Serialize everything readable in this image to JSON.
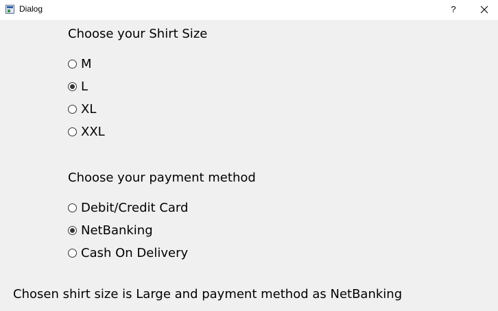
{
  "window": {
    "title": "Dialog",
    "help_label": "?"
  },
  "shirt": {
    "heading": "Choose your Shirt Size",
    "options": [
      {
        "label": "M",
        "checked": false
      },
      {
        "label": "L",
        "checked": true
      },
      {
        "label": "XL",
        "checked": false
      },
      {
        "label": "XXL",
        "checked": false
      }
    ]
  },
  "payment": {
    "heading": "Choose your payment method",
    "options": [
      {
        "label": "Debit/Credit Card",
        "checked": false
      },
      {
        "label": "NetBanking",
        "checked": true
      },
      {
        "label": "Cash On Delivery",
        "checked": false
      }
    ]
  },
  "status": {
    "text": "Chosen shirt size is Large and payment method as NetBanking"
  },
  "icons": {
    "app": "dialog-app-icon",
    "help": "help-icon",
    "close": "close-icon"
  }
}
